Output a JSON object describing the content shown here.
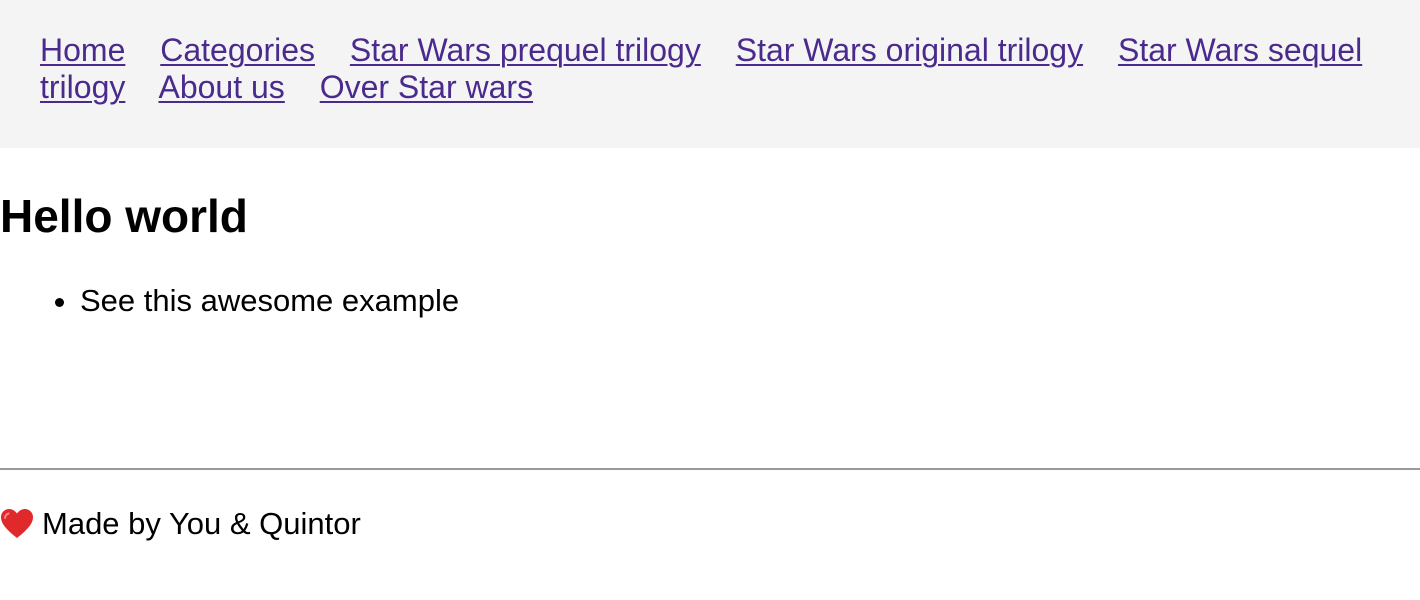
{
  "nav": {
    "links": [
      {
        "label": "Home"
      },
      {
        "label": "Categories"
      },
      {
        "label": "Star Wars prequel trilogy"
      },
      {
        "label": "Star Wars original trilogy"
      },
      {
        "label": "Star Wars sequel trilogy"
      },
      {
        "label": "About us"
      },
      {
        "label": "Over Star wars"
      }
    ]
  },
  "main": {
    "title": "Hello world",
    "items": [
      {
        "text": "See this awesome example"
      }
    ]
  },
  "footer": {
    "icon": "heart-icon",
    "text": "Made by You & Quintor"
  },
  "colors": {
    "link": "#4a2a8c",
    "nav_background": "#f4f4f4",
    "heart": "#e0292b"
  }
}
